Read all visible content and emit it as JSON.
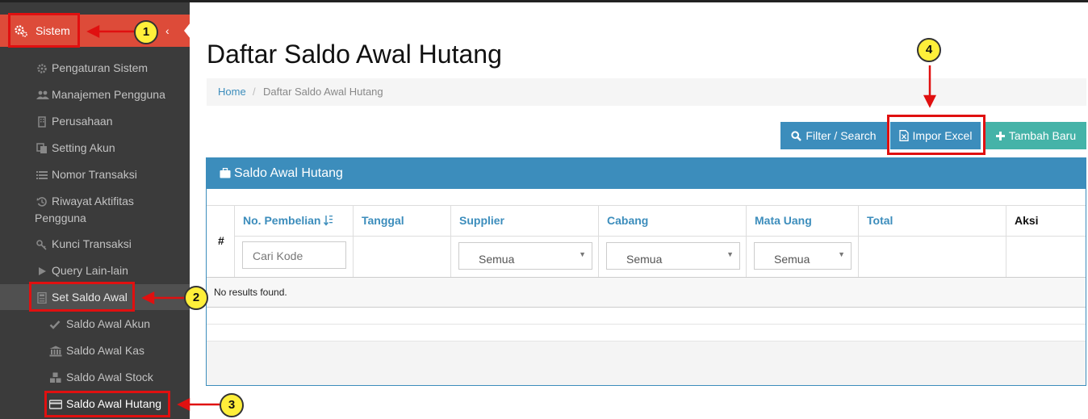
{
  "sidebar": {
    "sistem_label": "Sistem",
    "items": [
      {
        "label": "Pengaturan Sistem",
        "icon": "gear-icon"
      },
      {
        "label": "Manajemen Pengguna",
        "icon": "users-icon"
      },
      {
        "label": "Perusahaan",
        "icon": "building-icon"
      },
      {
        "label": "Setting Akun",
        "icon": "copy-icon"
      },
      {
        "label": "Nomor Transaksi",
        "icon": "list-icon"
      },
      {
        "label": "Riwayat Aktifitas",
        "label2": "Pengguna",
        "icon": "history-icon"
      },
      {
        "label": "Kunci Transaksi",
        "icon": "key-icon"
      },
      {
        "label": "Query Lain-lain",
        "icon": "play-icon"
      },
      {
        "label": "Set Saldo Awal",
        "icon": "calculator-icon"
      }
    ],
    "sub_items": [
      {
        "label": "Saldo Awal Akun",
        "icon": "check-icon"
      },
      {
        "label": "Saldo Awal Kas",
        "icon": "bank-icon"
      },
      {
        "label": "Saldo Awal Stock",
        "icon": "cubes-icon"
      },
      {
        "label": "Saldo Awal Hutang",
        "icon": "credit-card-icon"
      }
    ]
  },
  "page": {
    "title": "Daftar Saldo Awal Hutang",
    "breadcrumb": {
      "home": "Home",
      "separator": "/",
      "current": "Daftar Saldo Awal Hutang"
    }
  },
  "toolbar": {
    "filter_label": "Filter / Search",
    "impor_label": "Impor Excel",
    "tambah_label": "Tambah Baru"
  },
  "panel": {
    "title": "Saldo Awal Hutang",
    "columns": [
      "#",
      "No. Pembelian",
      "Tanggal",
      "Supplier",
      "Cabang",
      "Mata Uang",
      "Total",
      "Aksi"
    ],
    "filters": {
      "kode_placeholder": "Cari Kode",
      "supplier": "Semua",
      "cabang": "Semua",
      "mata_uang": "Semua"
    },
    "empty_text": "No results found."
  },
  "annotations": [
    "1",
    "2",
    "3",
    "4"
  ],
  "colors": {
    "sidebar_bg": "#3b3b3b",
    "accent_red": "#dd4b39",
    "primary_blue": "#3c8dbc",
    "teal": "#45b3a8",
    "callout_yellow": "#ffef3a",
    "annotation_red": "#e01010"
  }
}
